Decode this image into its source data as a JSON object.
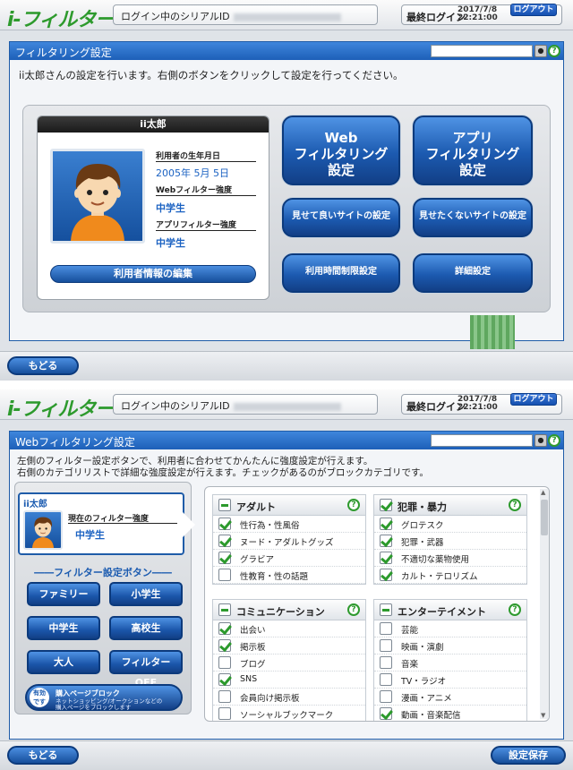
{
  "header": {
    "logo": "i-フィルター",
    "serial_label": "ログイン中のシリアルID",
    "last_login_label": "最終ログイン",
    "last_login_date": "2017/7/8",
    "last_login_time": "22:21:00",
    "logout": "ログアウト"
  },
  "screen1": {
    "title": "フィルタリング設定",
    "description": "ii太郎さんの設定を行います。右側のボタンをクリックして設定を行ってください。",
    "user": {
      "name": "ii太郎",
      "birth_label": "利用者の生年月日",
      "birth_value": "2005年 5月 5日",
      "web_strength_label": "Webフィルター強度",
      "web_strength_value": "中学生",
      "app_strength_label": "アプリフィルター強度",
      "app_strength_value": "中学生",
      "edit_button": "利用者情報の編集"
    },
    "buttons": {
      "web_line1": "Web",
      "web_line2": "フィルタリング",
      "web_line3": "設定",
      "app_line1": "アプリ",
      "app_line2": "フィルタリング",
      "app_line3": "設定",
      "allow_sites": "見せて良いサイトの設定",
      "block_sites": "見せたくないサイトの設定",
      "time_limit": "利用時間制限設定",
      "detail": "詳細設定"
    },
    "back": "もどる"
  },
  "screen2": {
    "title": "Webフィルタリング設定",
    "description_line1": "左側のフィルター設定ボタンで、利用者に合わせてかんたんに強度設定が行えます。",
    "description_line2": "右側のカテゴリリストで詳細な強度設定が行えます。チェックがあるのがブロックカテゴリです。",
    "user": {
      "name": "ii太郎",
      "current_label": "現在のフィルター強度",
      "current_value": "中学生"
    },
    "filter_section": "フィルター設定ボタン",
    "filter_buttons": [
      "ファミリー",
      "小学生",
      "中学生",
      "高校生",
      "大人",
      "フィルターOFF"
    ],
    "purchase": {
      "badge_line1": "有効",
      "badge_line2": "です",
      "title": "購入ページブロック",
      "desc_line1": "ネットショッピング/オークションなどの",
      "desc_line2": "購入ページをブロックします"
    },
    "categories": [
      {
        "name": "アダルト",
        "state": "minus",
        "items": [
          {
            "label": "性行為・性風俗",
            "checked": true
          },
          {
            "label": "ヌード・アダルトグッズ",
            "checked": true
          },
          {
            "label": "グラビア",
            "checked": true
          },
          {
            "label": "性教育・性の話題",
            "checked": false
          }
        ]
      },
      {
        "name": "犯罪・暴力",
        "state": "on",
        "items": [
          {
            "label": "グロテスク",
            "checked": true
          },
          {
            "label": "犯罪・武器",
            "checked": true
          },
          {
            "label": "不適切な薬物使用",
            "checked": true
          },
          {
            "label": "カルト・テロリズム",
            "checked": true
          }
        ]
      },
      {
        "name": "コミュニケーション",
        "state": "minus",
        "items": [
          {
            "label": "出会い",
            "checked": true
          },
          {
            "label": "掲示板",
            "checked": true
          },
          {
            "label": "ブログ",
            "checked": false
          },
          {
            "label": "SNS",
            "checked": true
          },
          {
            "label": "会員向け掲示板",
            "checked": false
          },
          {
            "label": "ソーシャルブックマーク",
            "checked": false
          }
        ]
      },
      {
        "name": "エンターテイメント",
        "state": "minus",
        "items": [
          {
            "label": "芸能",
            "checked": false
          },
          {
            "label": "映画・演劇",
            "checked": false
          },
          {
            "label": "音楽",
            "checked": false
          },
          {
            "label": "TV・ラジオ",
            "checked": false
          },
          {
            "label": "漫画・アニメ",
            "checked": false
          },
          {
            "label": "動画・音楽配信",
            "checked": true
          }
        ]
      }
    ],
    "back": "もどる",
    "save": "設定保存"
  }
}
